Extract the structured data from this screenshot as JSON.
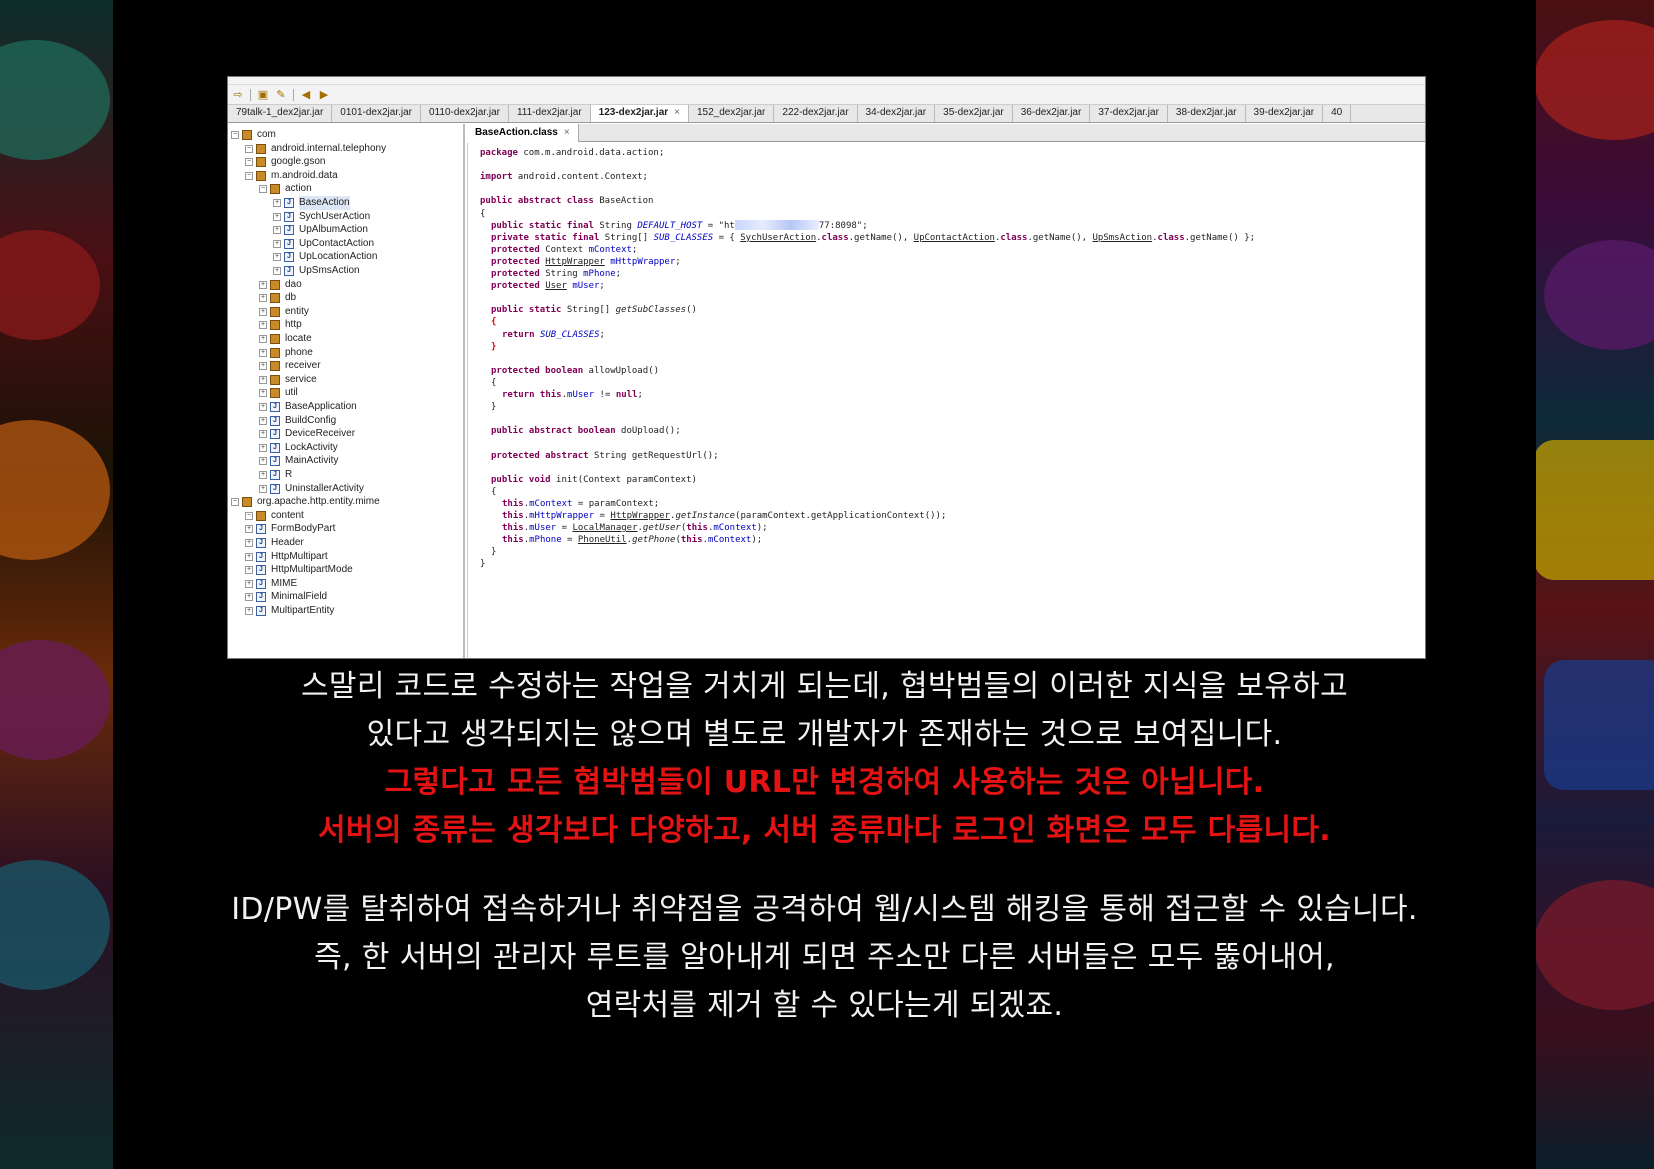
{
  "tabs": [
    "79talk-1_dex2jar.jar",
    "0101-dex2jar.jar",
    "0110-dex2jar.jar",
    "111-dex2jar.jar",
    "123-dex2jar.jar",
    "152_dex2jar.jar",
    "222-dex2jar.jar",
    "34-dex2jar.jar",
    "35-dex2jar.jar",
    "36-dex2jar.jar",
    "37-dex2jar.jar",
    "38-dex2jar.jar",
    "39-dex2jar.jar",
    "40"
  ],
  "active_tab": "123-dex2jar.jar",
  "tree": [
    {
      "label": "com",
      "type": "pkg",
      "depth": 0
    },
    {
      "label": "android.internal.telephony",
      "type": "pkg",
      "depth": 1
    },
    {
      "label": "google.gson",
      "type": "pkg",
      "depth": 1
    },
    {
      "label": "m.android.data",
      "type": "pkg",
      "depth": 1
    },
    {
      "label": "action",
      "type": "pkg",
      "depth": 2
    },
    {
      "label": "BaseAction",
      "type": "cls",
      "depth": 3
    },
    {
      "label": "SychUserAction",
      "type": "cls",
      "depth": 3
    },
    {
      "label": "UpAlbumAction",
      "type": "cls",
      "depth": 3
    },
    {
      "label": "UpContactAction",
      "type": "cls",
      "depth": 3
    },
    {
      "label": "UpLocationAction",
      "type": "cls",
      "depth": 3
    },
    {
      "label": "UpSmsAction",
      "type": "cls",
      "depth": 3
    },
    {
      "label": "dao",
      "type": "pkg",
      "depth": 2
    },
    {
      "label": "db",
      "type": "pkg",
      "depth": 2
    },
    {
      "label": "entity",
      "type": "pkg",
      "depth": 2
    },
    {
      "label": "http",
      "type": "pkg",
      "depth": 2
    },
    {
      "label": "locate",
      "type": "pkg",
      "depth": 2
    },
    {
      "label": "phone",
      "type": "pkg",
      "depth": 2
    },
    {
      "label": "receiver",
      "type": "pkg",
      "depth": 2
    },
    {
      "label": "service",
      "type": "pkg",
      "depth": 2
    },
    {
      "label": "util",
      "type": "pkg",
      "depth": 2
    },
    {
      "label": "BaseApplication",
      "type": "cls",
      "depth": 2
    },
    {
      "label": "BuildConfig",
      "type": "cls",
      "depth": 2
    },
    {
      "label": "DeviceReceiver",
      "type": "cls",
      "depth": 2
    },
    {
      "label": "LockActivity",
      "type": "cls",
      "depth": 2
    },
    {
      "label": "MainActivity",
      "type": "cls",
      "depth": 2
    },
    {
      "label": "R",
      "type": "cls",
      "depth": 2
    },
    {
      "label": "UninstallerActivity",
      "type": "cls",
      "depth": 2
    },
    {
      "label": "org.apache.http.entity.mime",
      "type": "pkg",
      "depth": 0
    },
    {
      "label": "content",
      "type": "pkg",
      "depth": 1
    },
    {
      "label": "FormBodyPart",
      "type": "cls",
      "depth": 1
    },
    {
      "label": "Header",
      "type": "cls",
      "depth": 1
    },
    {
      "label": "HttpMultipart",
      "type": "cls",
      "depth": 1
    },
    {
      "label": "HttpMultipartMode",
      "type": "cls",
      "depth": 1
    },
    {
      "label": "MIME",
      "type": "cls",
      "depth": 1
    },
    {
      "label": "MinimalField",
      "type": "cls",
      "depth": 1
    },
    {
      "label": "MultipartEntity",
      "type": "cls",
      "depth": 1
    }
  ],
  "code_tab": "BaseAction.class",
  "code": [
    {
      "row": 0,
      "ind": 0,
      "html": "<span class='kw'>package</span> com.m.android.data.action;"
    },
    {
      "row": 2,
      "ind": 0,
      "html": "<span class='kw'>import</span> android.content.Context;"
    },
    {
      "row": 4,
      "ind": 0,
      "html": "<span class='kw'>public abstract class</span> BaseAction"
    },
    {
      "row": 5,
      "ind": 0,
      "html": "{"
    },
    {
      "row": 6,
      "ind": 1,
      "html": "<span class='kw'>public static final</span> String <span class='fld'>DEFAULT_HOST</span> = \"ht<span class='blur'></span>77:8098\";"
    },
    {
      "row": 7,
      "ind": 1,
      "html": "<span class='kw'>private static final</span> String[] <span class='fld'>SUB_CLASSES</span> = { <span class='ul'>SychUserAction</span>.<span class='kw'>class</span>.getName(), <span class='ul'>UpContactAction</span>.<span class='kw'>class</span>.getName(), <span class='ul'>UpSmsAction</span>.<span class='kw'>class</span>.getName() };"
    },
    {
      "row": 8,
      "ind": 1,
      "html": "<span class='kw'>protected</span> Context <span style='color:#0000c0'>mContext</span>;"
    },
    {
      "row": 9,
      "ind": 1,
      "html": "<span class='kw'>protected</span> <span class='ul'>HttpWrapper</span> <span style='color:#0000c0'>mHttpWrapper</span>;"
    },
    {
      "row": 10,
      "ind": 1,
      "html": "<span class='kw'>protected</span> String <span style='color:#0000c0'>mPhone</span>;"
    },
    {
      "row": 11,
      "ind": 1,
      "html": "<span class='kw'>protected</span> <span class='ul'>User</span> <span style='color:#0000c0'>mUser</span>;"
    },
    {
      "row": 13,
      "ind": 1,
      "html": "<span class='kw'>public static</span> String[] <i>getSubClasses</i>()"
    },
    {
      "row": 14,
      "ind": 1,
      "html": "<span class='red'>{</span>"
    },
    {
      "row": 15,
      "ind": 2,
      "html": "<span class='kw'>return</span> <span class='fld'>SUB_CLASSES</span>;"
    },
    {
      "row": 16,
      "ind": 1,
      "html": "<span class='red'>}</span>"
    },
    {
      "row": 18,
      "ind": 1,
      "html": "<span class='kw'>protected boolean</span> allowUpload()"
    },
    {
      "row": 19,
      "ind": 1,
      "html": "{"
    },
    {
      "row": 20,
      "ind": 2,
      "html": "<span class='kw'>return this</span>.<span style='color:#0000c0'>mUser</span> != <span class='kw'>null</span>;"
    },
    {
      "row": 21,
      "ind": 1,
      "html": "}"
    },
    {
      "row": 23,
      "ind": 1,
      "html": "<span class='kw'>public abstract boolean</span> doUpload();"
    },
    {
      "row": 25,
      "ind": 1,
      "html": "<span class='kw'>protected abstract</span> String getRequestUrl();"
    },
    {
      "row": 27,
      "ind": 1,
      "html": "<span class='kw'>public void</span> init(Context paramContext)"
    },
    {
      "row": 28,
      "ind": 1,
      "html": "{"
    },
    {
      "row": 29,
      "ind": 2,
      "html": "<span class='kw'>this</span>.<span style='color:#0000c0'>mContext</span> = paramContext;"
    },
    {
      "row": 30,
      "ind": 2,
      "html": "<span class='kw'>this</span>.<span style='color:#0000c0'>mHttpWrapper</span> = <span class='ul'>HttpWrapper</span>.<i>getInstance</i>(paramContext.getApplicationContext());"
    },
    {
      "row": 31,
      "ind": 2,
      "html": "<span class='kw'>this</span>.<span style='color:#0000c0'>mUser</span> = <span class='ul'>LocalManager</span>.<i>getUser</i>(<span class='kw'>this</span>.<span style='color:#0000c0'>mContext</span>);"
    },
    {
      "row": 32,
      "ind": 2,
      "html": "<span class='kw'>this</span>.<span style='color:#0000c0'>mPhone</span> = <span class='ul'>PhoneUtil</span>.<i>getPhone</i>(<span class='kw'>this</span>.<span style='color:#0000c0'>mContext</span>);"
    },
    {
      "row": 33,
      "ind": 1,
      "html": "}"
    },
    {
      "row": 34,
      "ind": 0,
      "html": "}"
    }
  ],
  "captions": {
    "line1": "스말리 코드로 수정하는 작업을 거치게 되는데, 협박범들의 이러한 지식을 보유하고",
    "line2": "있다고 생각되지는 않으며 별도로 개발자가 존재하는 것으로 보여집니다.",
    "line3": "그렇다고 모든 협박범들이 URL만 변경하여 사용하는 것은 아닙니다.",
    "line4": "서버의 종류는 생각보다 다양하고, 서버 종류마다 로그인 화면은 모두 다릅니다.",
    "line5": "ID/PW를 탈취하여 접속하거나 취약점을 공격하여 웹/시스템 해킹을 통해 접근할 수 있습니다.",
    "line6": "즉, 한 서버의 관리자 루트를 알아내게 되면 주소만 다른 서버들은 모두 뚫어내어,",
    "line7": "연락처를 제거 할 수 있다는게 되겠죠."
  },
  "colors": {
    "caption_white": "#f2f2f2",
    "caption_red": "#e41313",
    "background": "#000000"
  }
}
